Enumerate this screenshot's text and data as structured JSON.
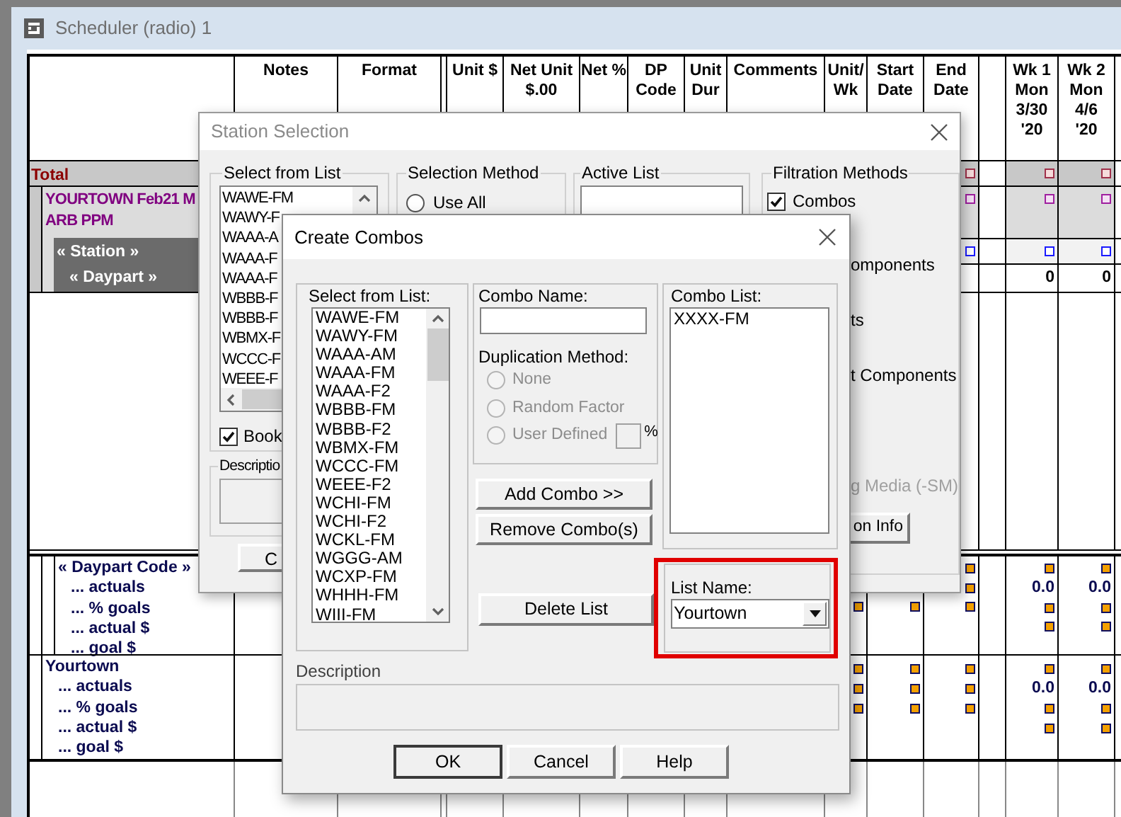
{
  "scheduler": {
    "title": "Scheduler (radio) 1",
    "columns": [
      "Notes",
      "Format",
      "Unit $",
      "Net Unit\n$.00",
      "Net %",
      "DP\nCode",
      "Unit\nDur",
      "Comments",
      "Unit/\nWk",
      "Start\nDate",
      "End\nDate"
    ],
    "weeks": [
      "Wk 1\nMon\n3/30\n'20",
      "Wk 2\nMon\n4/6\n'20"
    ],
    "rows": [
      {
        "kind": "total",
        "label": "Total"
      },
      {
        "kind": "market",
        "label": "YOURTOWN Feb21 M\nARB PPM"
      },
      {
        "kind": "station",
        "label": "« Station »"
      },
      {
        "kind": "daypart",
        "label": "« Daypart »",
        "week_values": [
          "0",
          "0"
        ]
      }
    ],
    "groups": [
      {
        "kind": "daypart_code",
        "title": "« Daypart Code »",
        "lines": [
          "... actuals",
          "... % goals",
          "... actual $",
          "... goal $"
        ],
        "week_values": [
          "0.0",
          "0.0"
        ]
      },
      {
        "kind": "market",
        "title": "Yourtown",
        "lines": [
          "... actuals",
          "... % goals",
          "... actual $",
          "... goal $"
        ],
        "week_values": [
          "0.0",
          "0.0"
        ]
      }
    ]
  },
  "station_selection": {
    "title": "Station Selection",
    "select_from_list": {
      "label": "Select from List",
      "items": [
        "WAWE-FM",
        "WAWY-F",
        "WAAA-A",
        "WAAA-F",
        "WAAA-F",
        "WBBB-F",
        "WBBB-F",
        "WBMX-F",
        "WCCC-F",
        "WEEE-F"
      ]
    },
    "book": {
      "label": "Book",
      "checked": true
    },
    "description": {
      "label": "Descriptio"
    },
    "button": "C",
    "selection_method": {
      "label": "Selection Method",
      "options": [
        {
          "label": "Use All",
          "selected": false
        }
      ]
    },
    "active_list": {
      "label": "Active List"
    },
    "filtration": {
      "label": "Filtration Methods",
      "combos": {
        "label": "Combos",
        "checked": true
      },
      "options": [
        {
          "label": "omponents",
          "disabled": false
        },
        {
          "label": "ts",
          "disabled": false
        },
        {
          "label": "t Components",
          "disabled": false
        },
        {
          "label": "g Media (-SM)",
          "disabled": true
        }
      ],
      "button": "on Info"
    }
  },
  "create_combos": {
    "title": "Create Combos",
    "select_from_list": {
      "label": "Select from List:",
      "items": [
        "WAWE-FM",
        "WAWY-FM",
        "WAAA-AM",
        "WAAA-FM",
        "WAAA-F2",
        "WBBB-FM",
        "WBBB-F2",
        "WBMX-FM",
        "WCCC-FM",
        "WEEE-F2",
        "WCHI-FM",
        "WCHI-F2",
        "WCKL-FM",
        "WGGG-AM",
        "WCXP-FM",
        "WHHH-FM",
        "WIII-FM"
      ]
    },
    "combo_name": {
      "label": "Combo Name:"
    },
    "duplication": {
      "label": "Duplication Method:",
      "options": [
        {
          "label": "None",
          "selected": false,
          "disabled": true
        },
        {
          "label": "Random Factor",
          "selected": false,
          "disabled": true
        },
        {
          "label": "User Defined",
          "selected": false,
          "disabled": true
        }
      ],
      "percent": "%"
    },
    "buttons": [
      {
        "kind": "add",
        "label": "Add Combo >>"
      },
      {
        "kind": "remove",
        "label": "Remove Combo(s)"
      },
      {
        "kind": "delete",
        "label": "Delete List"
      }
    ],
    "combo_list": {
      "label": "Combo List:",
      "items": [
        "XXXX-FM"
      ]
    },
    "list_name": {
      "label": "List Name:",
      "value": "Yourtown",
      "highlighted": true
    },
    "description": {
      "label": "Description"
    },
    "footer_buttons": [
      {
        "label": "OK",
        "default": true
      },
      {
        "label": "Cancel",
        "default": false
      },
      {
        "label": "Help",
        "default": false
      }
    ]
  }
}
